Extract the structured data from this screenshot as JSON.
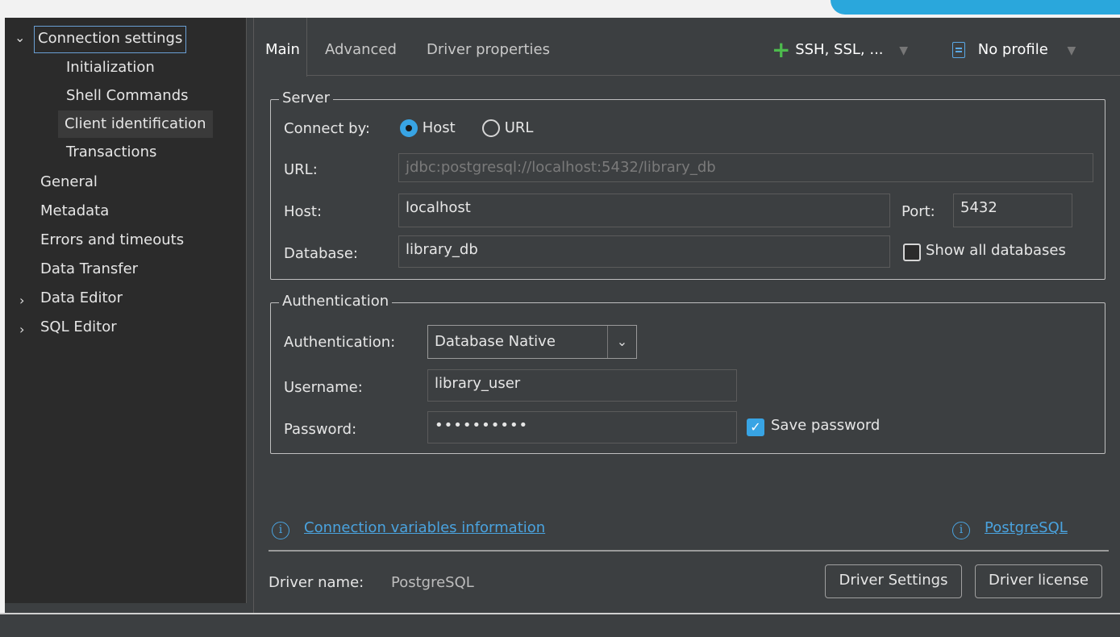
{
  "nav": {
    "items": [
      {
        "label": "Connection settings",
        "expanded": true
      },
      {
        "label": "Initialization"
      },
      {
        "label": "Shell Commands"
      },
      {
        "label": "Client identification"
      },
      {
        "label": "Transactions"
      },
      {
        "label": "General"
      },
      {
        "label": "Metadata"
      },
      {
        "label": "Errors and timeouts"
      },
      {
        "label": "Data Transfer"
      },
      {
        "label": "Data Editor",
        "expanded": false
      },
      {
        "label": "SQL Editor",
        "expanded": false
      }
    ]
  },
  "tabs": {
    "main": "Main",
    "advanced": "Advanced",
    "driver_properties": "Driver properties",
    "ssh_label": "SSH, SSL, ...",
    "profile_label": "No profile"
  },
  "server": {
    "title": "Server",
    "connect_by_label": "Connect by:",
    "host_option": "Host",
    "url_option": "URL",
    "connect_by_selected": "Host",
    "url_label": "URL:",
    "url_value": "jdbc:postgresql://localhost:5432/library_db",
    "host_label": "Host:",
    "host_value": "localhost",
    "port_label": "Port:",
    "port_value": "5432",
    "database_label": "Database:",
    "database_value": "library_db",
    "show_all_databases": "Show all databases",
    "show_all_checked": false
  },
  "auth": {
    "title": "Authentication",
    "auth_label": "Authentication:",
    "auth_value": "Database Native",
    "username_label": "Username:",
    "username_value": "library_user",
    "password_label": "Password:",
    "password_value": "••••••••••",
    "save_password": "Save password",
    "save_password_checked": true
  },
  "links": {
    "variables_info": "Connection variables information",
    "postgresql": "PostgreSQL"
  },
  "driver": {
    "name_label": "Driver name:",
    "name_value": "PostgreSQL",
    "settings_button": "Driver Settings",
    "license_button": "Driver license"
  },
  "colors": {
    "accent": "#38a4e4",
    "link": "#4aa3df",
    "add_icon": "#4dbb4d",
    "background": "#3c3f41",
    "nav_background": "#2b2b2b"
  }
}
